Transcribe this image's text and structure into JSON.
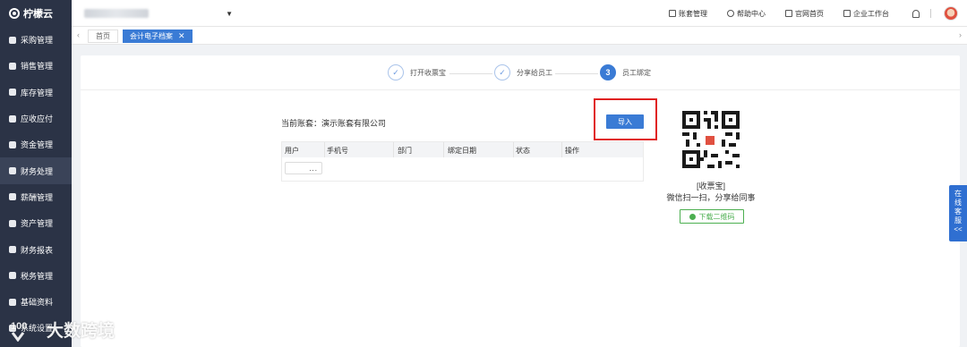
{
  "app": {
    "logo_text": "柠檬云"
  },
  "header": {
    "links": [
      {
        "label": "账套管理",
        "icon": "ledger-icon"
      },
      {
        "label": "帮助中心",
        "icon": "help-icon"
      },
      {
        "label": "官网首页",
        "icon": "home-icon"
      },
      {
        "label": "企业工作台",
        "icon": "monitor-icon"
      }
    ]
  },
  "sidebar": {
    "items": [
      {
        "label": "采购管理"
      },
      {
        "label": "销售管理"
      },
      {
        "label": "库存管理"
      },
      {
        "label": "应收应付"
      },
      {
        "label": "资金管理"
      },
      {
        "label": "财务处理"
      },
      {
        "label": "薪酬管理"
      },
      {
        "label": "资产管理"
      },
      {
        "label": "财务报表"
      },
      {
        "label": "税务管理"
      },
      {
        "label": "基础资料"
      },
      {
        "label": "系统设置"
      }
    ]
  },
  "tabs": {
    "home": "首页",
    "active": "会计电子档案",
    "close_glyph": "✕"
  },
  "steps": [
    {
      "label": "打开收票宝",
      "mark": "✓"
    },
    {
      "label": "分享给员工",
      "mark": "✓"
    },
    {
      "label": "员工绑定",
      "mark": "3"
    }
  ],
  "main": {
    "account_label": "当前账套：演示账套有限公司",
    "import_button": "导入",
    "table": {
      "columns": [
        "用户",
        "手机号",
        "部门",
        "绑定日期",
        "状态",
        "操作"
      ],
      "row_placeholder": "..."
    }
  },
  "qr": {
    "caption1": "[收票宝]",
    "caption2": "微信扫一扫，分享给同事",
    "download_label": "下载二维码"
  },
  "service": {
    "label": "在线客服",
    "arrows": "<<"
  },
  "watermark": {
    "text": "大数跨境",
    "mark": "100"
  },
  "colors": {
    "sidebar_bg": "#2b3346",
    "primary": "#3a7bd5",
    "highlight": "#e02020",
    "success": "#4caf50"
  }
}
